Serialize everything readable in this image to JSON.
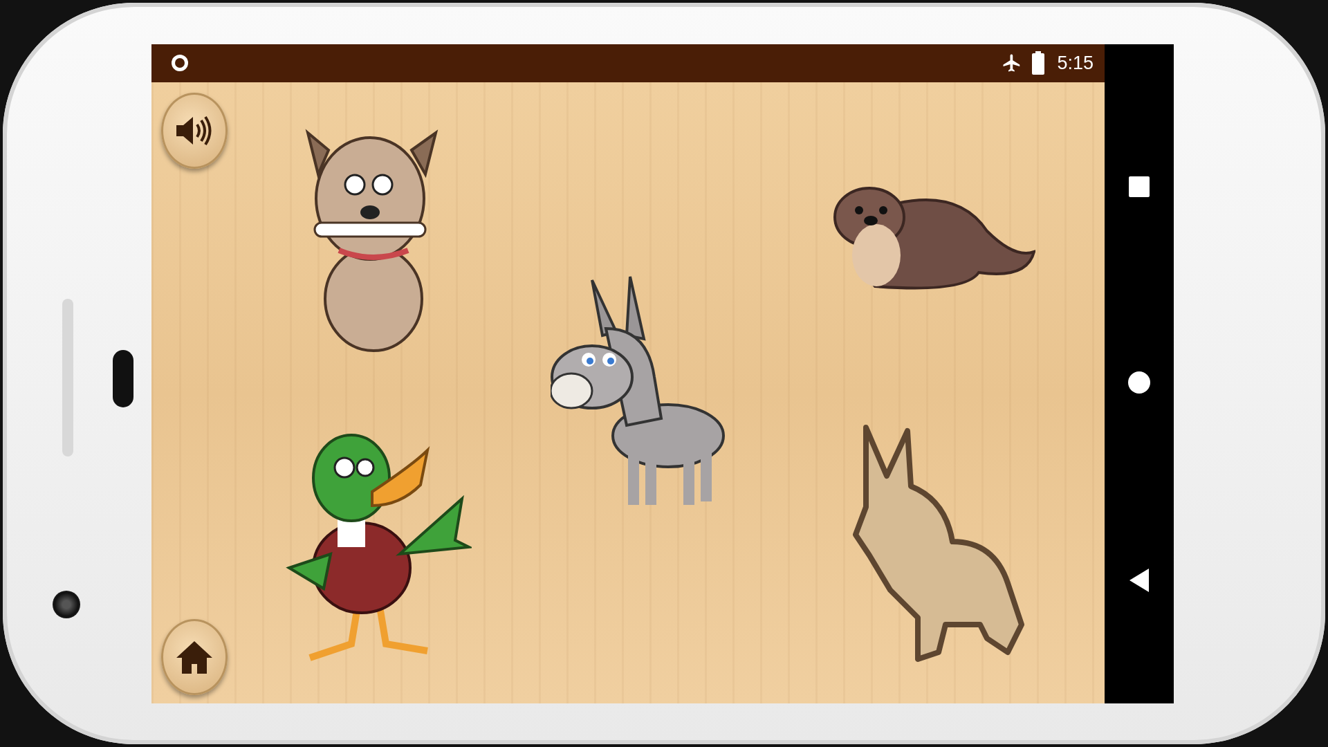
{
  "status_bar": {
    "time": "5:15"
  }
}
